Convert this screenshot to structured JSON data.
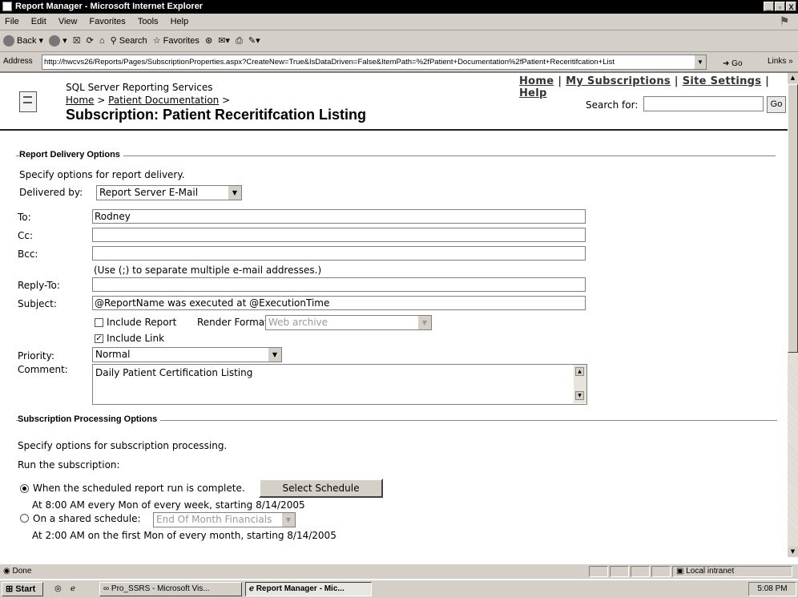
{
  "window": {
    "title": "Report Manager - Microsoft Internet Explorer",
    "controls": [
      "_",
      "▫",
      "X"
    ]
  },
  "menu": [
    "File",
    "Edit",
    "View",
    "Favorites",
    "Tools",
    "Help"
  ],
  "toolbar": {
    "back": "Back",
    "search": "Search",
    "favorites": "Favorites"
  },
  "address": {
    "label": "Address",
    "url": "http://hwcvs26/Reports/Pages/SubscriptionProperties.aspx?CreateNew=True&IsDataDriven=False&ItemPath=%2fPatient+Documentation%2fPatient+Receritifcation+List",
    "go": "Go",
    "links": "Links"
  },
  "header": {
    "site": "SQL Server Reporting Services",
    "crumb_home": "Home",
    "crumb_sep1": ">",
    "crumb_folder": "Patient Documentation",
    "crumb_sep2": ">",
    "title": "Subscription: Patient Receritifcation Listing",
    "links": {
      "home": "Home",
      "subs": "My Subscriptions",
      "settings": "Site Settings",
      "help": "Help",
      "sep": "|"
    },
    "search_label": "Search for:",
    "search_go": "Go"
  },
  "delivery": {
    "section": "Report Delivery Options",
    "desc": "Specify options for report delivery.",
    "delivered_by_label": "Delivered by:",
    "delivered_by": "Report Server E-Mail",
    "to_label": "To:",
    "to": "Rodney",
    "cc_label": "Cc:",
    "cc": "",
    "bcc_label": "Bcc:",
    "bcc": "",
    "hint": "(Use (;) to separate multiple e-mail addresses.)",
    "reply_label": "Reply-To:",
    "reply": "",
    "subject_label": "Subject:",
    "subject": "@ReportName was executed at @ExecutionTime",
    "include_report": "Include Report",
    "render_label": "Render Format:",
    "render": "Web archive",
    "include_link": "Include Link",
    "priority_label": "Priority:",
    "priority": "Normal",
    "comment_label": "Comment:",
    "comment": "Daily Patient Certification Listing"
  },
  "processing": {
    "section": "Subscription Processing Options",
    "desc": "Specify options for subscription processing.",
    "run_label": "Run the subscription:",
    "opt1": "When the scheduled report run is complete.",
    "select_schedule": "Select Schedule",
    "opt1_detail": "At 8:00 AM every Mon of every week, starting 8/14/2005",
    "opt2": "On a shared schedule:",
    "shared": "End Of Month Financials",
    "opt2_detail": "At 2:00 AM on the first Mon of every month, starting 8/14/2005"
  },
  "status": {
    "text": "Done",
    "zone": "Local intranet"
  },
  "taskbar": {
    "start": "Start",
    "task1": "Pro_SSRS - Microsoft Vis...",
    "task2": "Report Manager - Mic...",
    "clock": "5:08 PM"
  }
}
